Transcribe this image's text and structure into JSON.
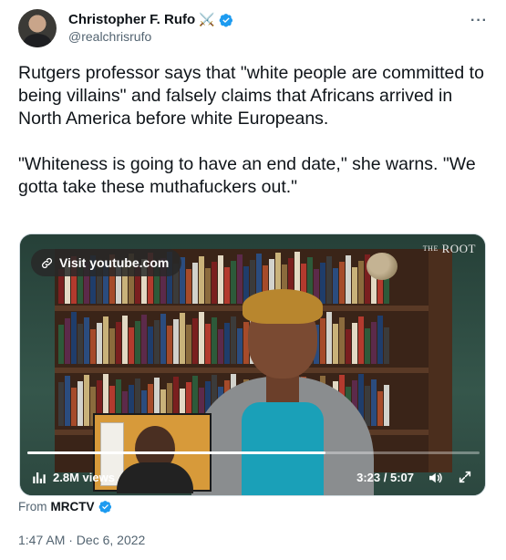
{
  "author": {
    "name": "Christopher F. Rufo",
    "name_emoji": "⚔️",
    "handle": "@realchrisrufo"
  },
  "more_menu": "···",
  "tweet": {
    "text": "Rutgers professor says that \"white people are committed to being villains\" and falsely claims that Africans arrived in North America before white Europeans.\n\n\"Whiteness is going to have an end date,\" she warns. \"We gotta take these muthafuckers out.\""
  },
  "media": {
    "visit_link": "Visit youtube.com",
    "logo_the": "THE",
    "logo_name": "ROOT",
    "views": "2.8M views",
    "time": "3:23 / 5:07",
    "progress": 0.66
  },
  "source": {
    "from_label": "From",
    "name": "MRCTV"
  },
  "timestamp": "1:47 AM · Dec 6, 2022",
  "colors": {
    "verified_blue": "#1d9bf0",
    "secondary_text": "#536471",
    "primary_text": "#0f1419"
  },
  "icons": [
    "more-icon",
    "verified-icon",
    "link-icon",
    "views-icon",
    "volume-icon",
    "fullscreen-icon"
  ]
}
